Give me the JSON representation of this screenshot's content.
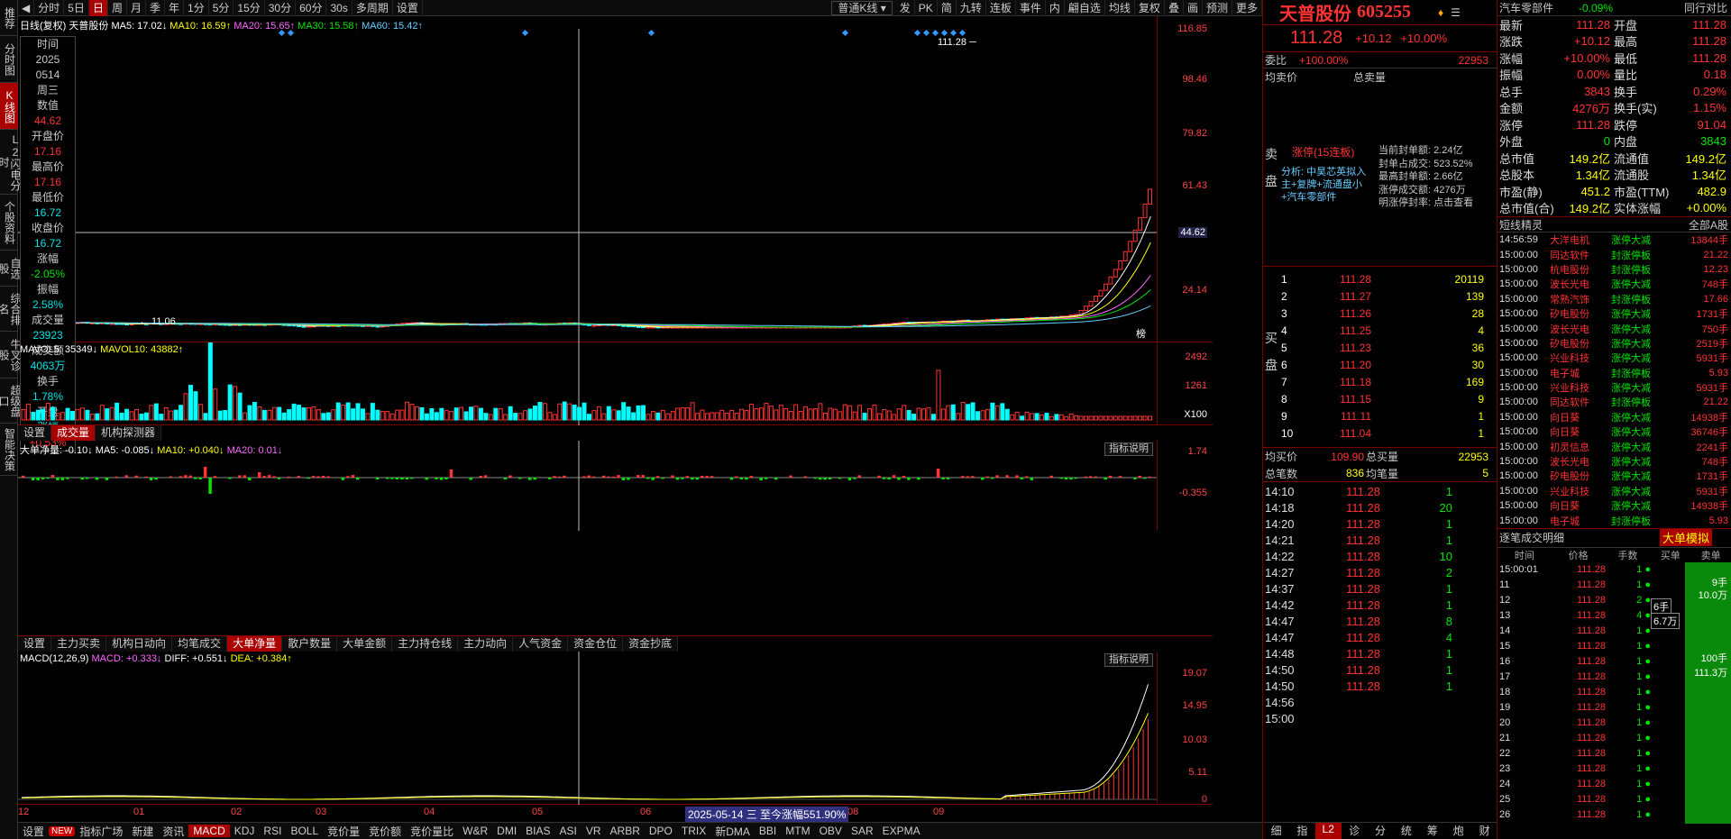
{
  "sidebar": [
    "推荐",
    "分时图",
    "K线图",
    "L2闪电分时",
    "个股资料",
    "自选股",
    "综合排名",
    "牛叉诊股",
    "超级盘口",
    "智能决策"
  ],
  "toolbar": {
    "items": [
      "分时",
      "5日",
      "日",
      "周",
      "月",
      "季",
      "年",
      "1分",
      "5分",
      "15分",
      "30分",
      "60分",
      "30s",
      "多周期",
      "设置"
    ],
    "active": "日",
    "select": "普通K线",
    "right": [
      "发",
      "PK",
      "简",
      "九转",
      "连板",
      "事件",
      "内",
      "翩自选",
      "均线",
      "复权",
      "叠",
      "画",
      "预测",
      "更多"
    ]
  },
  "kline": {
    "header": "日线(复权)",
    "stock": "天普股份",
    "ma5": "MA5: 17.02↓",
    "ma10": "MA10: 16.59↑",
    "ma20": "MA20: 15.65↑",
    "ma30": "MA30: 15.58↑",
    "ma60": "MA60: 15.42↑",
    "yticks": [
      "116.85",
      "98.46",
      "79.82",
      "61.43",
      "44.62",
      "42.79",
      "24.14"
    ],
    "cross_price": "44.62",
    "high_label": "111.28",
    "low_label": "11.06",
    "badge": "榜"
  },
  "info": {
    "labels": [
      "时间",
      "2025",
      "0514",
      "周三",
      "数值",
      "44.62",
      "开盘价",
      "17.16",
      "最高价",
      "17.16",
      "最低价",
      "16.72",
      "收盘价",
      "16.72",
      "涨幅",
      "-2.05%",
      "振幅",
      "2.58%",
      "成交量",
      "23923",
      "成交额",
      "4063万",
      "换手",
      "1.78%",
      "开盘",
      "涨幅",
      "+0.53%"
    ]
  },
  "volume": {
    "ma5": "MAVOL5: 35349↓",
    "ma10": "MAVOL10: 43882↑",
    "yticks": [
      "2492",
      "1261",
      "X100"
    ]
  },
  "subtabs1": [
    "设置",
    "成交量",
    "机构探测器"
  ],
  "bigorder": {
    "title": "大单净量",
    "value": "大单净量: -0.10↓",
    "ma5": "MA5: -0.085↓",
    "ma10": "MA10: +0.040↓",
    "ma20": "MA20: 0.01↓",
    "yticks": [
      "1.74",
      "-0.355"
    ],
    "btn": "指标说明"
  },
  "subtabs2": [
    "设置",
    "主力买卖",
    "机构日动向",
    "均笔成交",
    "大单净量",
    "散户数量",
    "大单金额",
    "主力持仓线",
    "主力动向",
    "人气资金",
    "资金仓位",
    "资金抄底"
  ],
  "macd": {
    "title": "MACD(12,26,9)",
    "macd": "MACD: +0.333↓",
    "diff": "DIFF: +0.551↓",
    "dea": "DEA: +0.384↑",
    "yticks": [
      "19.07",
      "14.95",
      "10.03",
      "5.11",
      "0"
    ],
    "btn": "指标说明"
  },
  "xaxis": [
    "12",
    "01",
    "02",
    "03",
    "04",
    "05",
    "06",
    "07",
    "08",
    "09"
  ],
  "xaxis_label": "2025-05-14 三 至今涨幅551.90%",
  "bottom": [
    "设置",
    "NEW",
    "指标广场",
    "新建",
    "资讯",
    "MACD",
    "KDJ",
    "RSI",
    "BOLL",
    "竞价量",
    "竞价额",
    "竞价量比",
    "W&R",
    "DMI",
    "BIAS",
    "ASI",
    "VR",
    "ARBR",
    "DPO",
    "TRIX",
    "新DMA",
    "BBI",
    "MTM",
    "OBV",
    "SAR",
    "EXPMA"
  ],
  "quote": {
    "name": "天普股份",
    "code": "605255",
    "price": "111.28",
    "chg": "+10.12",
    "pct": "+10.00%",
    "weibi_label": "委比",
    "weibi": "+100.00%",
    "weibi_v": "22953",
    "jmj": "均卖价",
    "zmj": "总卖量",
    "limit_title": "涨停(15连板)",
    "limit_info": [
      "当前封单额: 2.24亿",
      "封单占成交: 523.52%",
      "最高封单额: 2.66亿",
      "涨停成交额: 4276万",
      "明涨停封率: 点击查看"
    ],
    "analysis": "分析: 中昊芯英拟入主+复牌+流通盘小+汽车零部件",
    "sell_label": "卖盘",
    "buy_label": "买盘",
    "bids": [
      [
        "1",
        "111.28",
        "20119"
      ],
      [
        "2",
        "111.27",
        "139"
      ],
      [
        "3",
        "111.26",
        "28"
      ],
      [
        "4",
        "111.25",
        "4"
      ],
      [
        "5",
        "111.23",
        "36"
      ],
      [
        "6",
        "111.20",
        "30"
      ],
      [
        "7",
        "111.18",
        "169"
      ],
      [
        "8",
        "111.15",
        "9"
      ],
      [
        "9",
        "111.11",
        "1"
      ],
      [
        "10",
        "111.04",
        "1"
      ]
    ],
    "avgbuy": [
      "均买价",
      "109.90",
      "总买量",
      "22953"
    ],
    "total": [
      "总笔数",
      "836",
      "均笔量",
      "5"
    ],
    "ticks": [
      [
        "14:10",
        "111.28",
        "1"
      ],
      [
        "14:18",
        "111.28",
        "20"
      ],
      [
        "14:20",
        "111.28",
        "1"
      ],
      [
        "14:21",
        "111.28",
        "1"
      ],
      [
        "14:22",
        "111.28",
        "10"
      ],
      [
        "14:27",
        "111.28",
        "2"
      ],
      [
        "14:37",
        "111.28",
        "1"
      ],
      [
        "14:42",
        "111.28",
        "1"
      ],
      [
        "14:47",
        "111.28",
        "8"
      ],
      [
        "14:47",
        "111.28",
        "4"
      ],
      [
        "14:48",
        "111.28",
        "1"
      ],
      [
        "14:50",
        "111.28",
        "1"
      ],
      [
        "14:50",
        "111.28",
        "1"
      ],
      [
        "14:56",
        "",
        " "
      ],
      [
        "15:00",
        "",
        ""
      ]
    ],
    "tabs": [
      "细",
      "指",
      "L2",
      "诊",
      "分",
      "统",
      "筹",
      "炮",
      "财"
    ]
  },
  "stats": {
    "sector": "汽车零部件",
    "sector_pct": "-0.09%",
    "peer": "同行对比",
    "rows": [
      [
        "最新",
        "111.28",
        "开盘",
        "111.28"
      ],
      [
        "涨跌",
        "+10.12",
        "最高",
        "111.28"
      ],
      [
        "涨幅",
        "+10.00%",
        "最低",
        "111.28"
      ],
      [
        "振幅",
        "0.00%",
        "量比",
        "0.18"
      ],
      [
        "总手",
        "3843",
        "换手",
        "0.29%"
      ],
      [
        "金额",
        "4276万",
        "换手(实)",
        "1.15%"
      ],
      [
        "涨停",
        "111.28",
        "跌停",
        "91.04"
      ],
      [
        "外盘",
        "0",
        "内盘",
        "3843"
      ],
      [
        "总市值",
        "149.2亿",
        "流通值",
        "149.2亿"
      ],
      [
        "总股本",
        "1.34亿",
        "流通股",
        "1.34亿"
      ],
      [
        "市盈(静)",
        "451.2",
        "市盈(TTM)",
        "482.9"
      ],
      [
        "总市值(合)",
        "149.2亿",
        "实体涨幅",
        "+0.00%"
      ]
    ],
    "ddx_title": "短线精灵",
    "ddx_filter": "全部A股",
    "ddx": [
      [
        "14:56:59",
        "大洋电机",
        "涨停大减",
        "13844手"
      ],
      [
        "15:00:00",
        "同达软件",
        "封涨停板",
        "21.22"
      ],
      [
        "15:00:00",
        "杭电股份",
        "封涨停板",
        "12.23"
      ],
      [
        "15:00:00",
        "波长光电",
        "涨停大减",
        "748手"
      ],
      [
        "15:00:00",
        "常熟汽饰",
        "封涨停板",
        "17.66"
      ],
      [
        "15:00:00",
        "矽电股份",
        "涨停大减",
        "1731手"
      ],
      [
        "15:00:00",
        "波长光电",
        "涨停大减",
        "750手"
      ],
      [
        "15:00:00",
        "矽电股份",
        "涨停大减",
        "2519手"
      ],
      [
        "15:00:00",
        "兴业科技",
        "涨停大减",
        "5931手"
      ],
      [
        "15:00:00",
        "电子城",
        "封涨停板",
        "5.93"
      ],
      [
        "15:00:00",
        "兴业科技",
        "涨停大减",
        "5931手"
      ],
      [
        "15:00:00",
        "同达软件",
        "封涨停板",
        "21.22"
      ],
      [
        "15:00:00",
        "向日葵",
        "涨停大减",
        "14938手"
      ],
      [
        "15:00:00",
        "向日葵",
        "涨停大减",
        "36746手"
      ],
      [
        "15:00:00",
        "初灵信息",
        "涨停大减",
        "2241手"
      ],
      [
        "15:00:00",
        "波长光电",
        "涨停大减",
        "748手"
      ],
      [
        "15:00:00",
        "矽电股份",
        "涨停大减",
        "1731手"
      ],
      [
        "15:00:00",
        "兴业科技",
        "涨停大减",
        "5931手"
      ],
      [
        "15:00:00",
        "向日葵",
        "涨停大减",
        "14938手"
      ],
      [
        "15:00:00",
        "电子城",
        "封涨停板",
        "5.93"
      ]
    ],
    "detail_title": "逐笔成交明细",
    "detail_btn": "大单模拟",
    "detail_cols": [
      "时间",
      "价格",
      "手数",
      "买单",
      "卖单"
    ],
    "detail": [
      [
        "15:00:01",
        "111.28",
        "1"
      ],
      [
        "11",
        "111.28",
        "1"
      ],
      [
        "12",
        "111.28",
        "2"
      ],
      [
        "13",
        "111.28",
        "4"
      ],
      [
        "14",
        "111.28",
        "1"
      ],
      [
        "15",
        "111.28",
        "1"
      ],
      [
        "16",
        "111.28",
        "1"
      ],
      [
        "17",
        "111.28",
        "1"
      ],
      [
        "18",
        "111.28",
        "1"
      ],
      [
        "19",
        "111.28",
        "1"
      ],
      [
        "20",
        "111.28",
        "1"
      ],
      [
        "21",
        "111.28",
        "1"
      ],
      [
        "22",
        "111.28",
        "1"
      ],
      [
        "23",
        "111.28",
        "1"
      ],
      [
        "24",
        "111.28",
        "1"
      ],
      [
        "25",
        "111.28",
        "1"
      ],
      [
        "26",
        "111.28",
        "1"
      ]
    ],
    "side_vals": [
      "9手",
      "10.0万",
      "6手",
      "6.7万",
      "100手",
      "111.3万"
    ]
  }
}
